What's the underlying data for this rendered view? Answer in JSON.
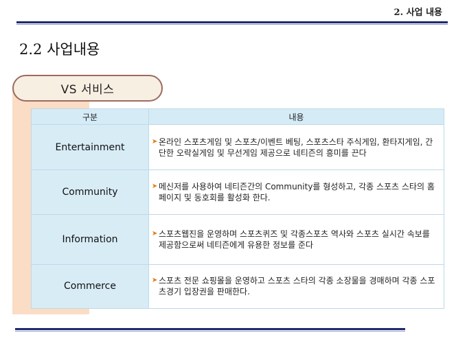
{
  "header": {
    "title": "2. 사업 내용"
  },
  "section": {
    "heading": "2.2 사업내용"
  },
  "banner": {
    "label": "VS 서비스"
  },
  "table": {
    "headers": [
      "구분",
      "내용"
    ],
    "rows": [
      {
        "category": "Entertainment",
        "description": "온라인 스포츠게임 및 스포츠/이벤트 베팅, 스포츠스타 주식게임, 환타지게임, 간단한 오락실게임  및 무선게임 제공으로 네티즌의 흥미를 끈다"
      },
      {
        "category": "Community",
        "description": "메신저를 사용하여 네티즌간의 Community를 형성하고, 각종 스포츠 스타의 홈페이지 및 동호회를 활성화 한다."
      },
      {
        "category": "Information",
        "description": "스포츠웹진을 운영하며 스포츠퀴즈 및 각종스포츠 역사와 스포츠 실시간 속보를 제공함으로써 네티즌에게 유용한 정보를 준다"
      },
      {
        "category": "Commerce",
        "description": "스포츠 전문 쇼핑몰을 운영하고 스포츠 스타의 각종 소장물을 경매하며 각종 스포츠경기 입장권을 판매한다."
      }
    ]
  },
  "colors": {
    "rule": "#1f2a6e",
    "accent": "#fbdcc4",
    "table_header": "#d5ecf7",
    "arrow": "#e07a12"
  },
  "icons": {
    "bullet": "arrow-right-icon"
  }
}
